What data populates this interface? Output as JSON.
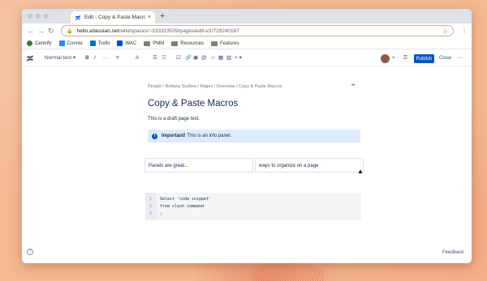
{
  "browser": {
    "tab_title": "Edit - Copy & Paste Macros - C",
    "tab_close": "×",
    "new_tab": "+",
    "url_host": "hello.atlassian.net",
    "url_path": "/wiki/spaces/~333323509/pages/edit-v2/729240167",
    "back": "←",
    "forward": "→",
    "reload": "↻",
    "bookmarks": [
      {
        "label": "Centrify",
        "color": "#2e7d32"
      },
      {
        "label": "Connie",
        "color": "#2684ff"
      },
      {
        "label": "Trello",
        "color": "#0079bf"
      },
      {
        "label": "WAC",
        "color": "#0052cc"
      },
      {
        "label": "PMM",
        "color": "folder"
      },
      {
        "label": "Resources",
        "color": "folder"
      },
      {
        "label": "Features",
        "color": "folder"
      }
    ]
  },
  "toolbar": {
    "text_style": "Normal text",
    "bold": "B",
    "italic": "I",
    "more_format": "···",
    "align": "≡",
    "text_color": "A",
    "bullet_list": "☰",
    "numbered_list": "☷",
    "publish_label": "Publish",
    "close_label": "Close",
    "more_label": "···",
    "add_label": "+"
  },
  "page": {
    "breadcrumb": [
      "People",
      "Brittany Sudlow",
      "Pages",
      "Overview",
      "Copy & Paste Macros"
    ],
    "breadcrumb_sep": " / ",
    "breadcrumb_text": "People  /  Brittany Sudlow  /  Pages  /  Overview  /  Copy & Paste Macros",
    "title": "Copy & Paste Macros",
    "paragraph": "This is a draft page test.",
    "info_panel": {
      "strong": "Important!",
      "text": " This is an info panel."
    },
    "table_cells": [
      "Panels are great…",
      "ways to organize on a page"
    ],
    "code": {
      "lines": [
        "Select 'code snippet'",
        "from slash command",
        ";"
      ],
      "line_numbers": [
        "1",
        "2",
        "3"
      ]
    }
  },
  "footer": {
    "help": "?",
    "feedback": "Feedback"
  }
}
